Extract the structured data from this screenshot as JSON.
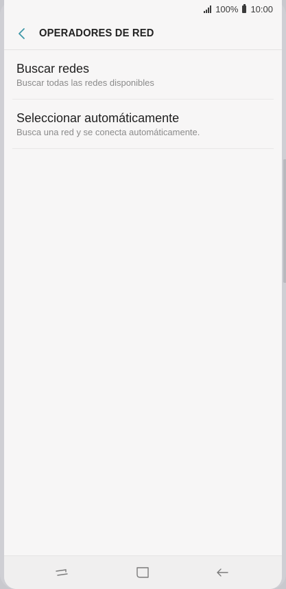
{
  "status_bar": {
    "battery": "100%",
    "time": "10:00",
    "icons": [
      "signal-icon",
      "battery-icon"
    ]
  },
  "header": {
    "title": "OPERADORES DE RED",
    "back_icon": "chevron-left-icon",
    "accent_color": "#3d97a8"
  },
  "items": [
    {
      "title": "Buscar redes",
      "subtitle": "Buscar todas las redes disponibles"
    },
    {
      "title": "Seleccionar automáticamente",
      "subtitle": "Busca una red y se conecta automáticamente."
    }
  ],
  "nav_bar": {
    "icons": [
      "recents-icon",
      "home-icon",
      "back-arrow-icon"
    ]
  }
}
